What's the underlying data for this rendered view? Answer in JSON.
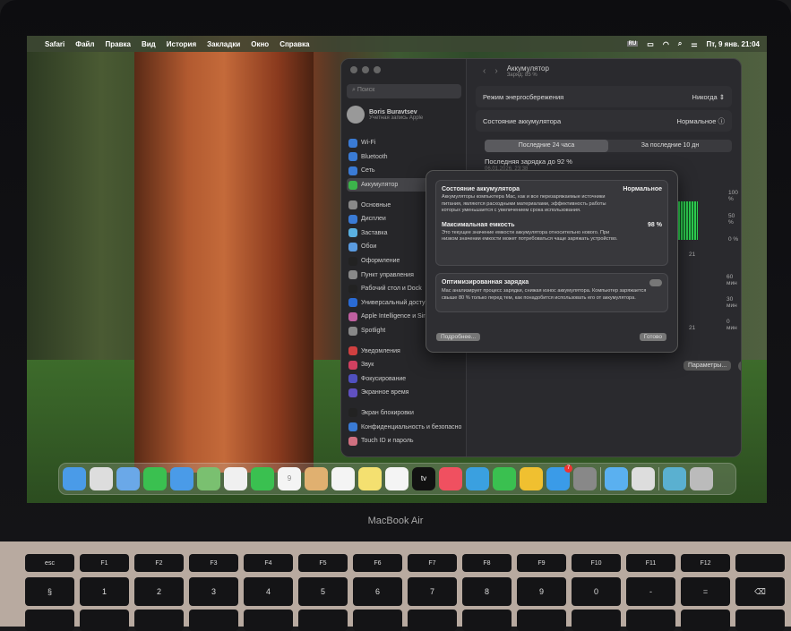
{
  "menubar": {
    "apple": "",
    "items": [
      "Safari",
      "Файл",
      "Правка",
      "Вид",
      "История",
      "Закладки",
      "Окно",
      "Справка"
    ],
    "input_lang": "RU",
    "clock": "Пт, 9 янв. 21:04"
  },
  "settings": {
    "search_placeholder": "Поиск",
    "user": {
      "name": "Boris Buravtsev",
      "subtitle": "Учетная запись Apple"
    },
    "sidebar": [
      {
        "label": "Wi-Fi",
        "color": "#3a7bd5"
      },
      {
        "label": "Bluetooth",
        "color": "#3a7bd5"
      },
      {
        "label": "Сеть",
        "color": "#3a7bd5"
      },
      {
        "label": "Аккумулятор",
        "color": "#3cb44b",
        "selected": true
      },
      {
        "label": "Основные",
        "color": "#888",
        "gap": true
      },
      {
        "label": "Дисплеи",
        "color": "#3a7bd5"
      },
      {
        "label": "Заставка",
        "color": "#5ab0e0"
      },
      {
        "label": "Обои",
        "color": "#5a9be0"
      },
      {
        "label": "Оформление",
        "color": "#222"
      },
      {
        "label": "Пункт управления",
        "color": "#888"
      },
      {
        "label": "Рабочий стол и Dock",
        "color": "#222"
      },
      {
        "label": "Универсальный доступ",
        "color": "#2a6bd5"
      },
      {
        "label": "Apple Intelligence и Siri",
        "color": "#c060a0"
      },
      {
        "label": "Spotlight",
        "color": "#888"
      },
      {
        "label": "Уведомления",
        "color": "#d04040",
        "gap": true
      },
      {
        "label": "Звук",
        "color": "#d04060"
      },
      {
        "label": "Фокусирование",
        "color": "#5050c0"
      },
      {
        "label": "Экранное время",
        "color": "#6050c0"
      },
      {
        "label": "Экран блокировки",
        "color": "#222",
        "gap": true
      },
      {
        "label": "Конфиденциальность и безопасность",
        "color": "#3a7bd5"
      },
      {
        "label": "Touch ID и пароль",
        "color": "#d07080"
      }
    ],
    "header": {
      "title": "Аккумулятор",
      "subtitle": "Заряд: 85 %"
    },
    "low_power": {
      "label": "Режим энергосбережения",
      "value": "Никогда"
    },
    "health": {
      "label": "Состояние аккумулятора",
      "value": "Нормальное"
    },
    "tabs": [
      "Последние 24 часа",
      "За последние 10 дн"
    ],
    "last_charge": {
      "label": "Последняя зарядка до 92 %",
      "date": "06.01.2026, 23:38"
    },
    "chart": {
      "level_ticks": [
        "100 %",
        "50 %",
        "0 %"
      ],
      "time_ticks": [
        "60 мин",
        "30 мин",
        "0 мин"
      ],
      "x_tick": "21"
    },
    "params_button": "Параметры...",
    "help": "?"
  },
  "dialog": {
    "health_title": "Состояние аккумулятора",
    "health_value": "Нормальное",
    "health_text": "Аккумуляторы компьютера Mac, как и все перезаряжаемые источники питания, являются расходными материалами, эффективность работы которых уменьшается с увеличением срока использования.",
    "capacity_title": "Максимальная емкость",
    "capacity_value": "98 %",
    "capacity_text": "Это текущее значение емкости аккумулятора относительно нового. При низком значении емкости может потребоваться чаще заряжать устройство.",
    "opt_title": "Оптимизированная зарядка",
    "opt_enabled": false,
    "opt_text": "Mac анализирует процесс зарядки, снижая износ аккумулятора. Компьютер заряжается свыше 80 % только перед тем, как понадобится использовать его от аккумулятора.",
    "more_button": "Подробнее...",
    "done_button": "Готово"
  },
  "dock": [
    {
      "name": "finder",
      "color": "#4a9be8"
    },
    {
      "name": "launchpad",
      "color": "#ddd"
    },
    {
      "name": "safari",
      "color": "#6aa8e8"
    },
    {
      "name": "messages",
      "color": "#3ac050"
    },
    {
      "name": "mail",
      "color": "#4a9be8"
    },
    {
      "name": "maps",
      "color": "#7ac070"
    },
    {
      "name": "photos",
      "color": "#f0f0f0"
    },
    {
      "name": "facetime",
      "color": "#3ac050"
    },
    {
      "name": "calendar",
      "color": "#f4f4f4",
      "text": "9"
    },
    {
      "name": "contacts",
      "color": "#e0b070"
    },
    {
      "name": "reminders",
      "color": "#f4f4f4"
    },
    {
      "name": "notes",
      "color": "#f4e070"
    },
    {
      "name": "freeform",
      "color": "#f4f4f4"
    },
    {
      "name": "tv",
      "color": "#111",
      "text": "tv"
    },
    {
      "name": "music",
      "color": "#f05060"
    },
    {
      "name": "keynote",
      "color": "#3aa0e0"
    },
    {
      "name": "numbers",
      "color": "#3ac050"
    },
    {
      "name": "pages",
      "color": "#f0c030"
    },
    {
      "name": "app-store",
      "color": "#3a9be8",
      "badge": "7"
    },
    {
      "name": "system-settings",
      "color": "#888"
    },
    {
      "sep": true
    },
    {
      "name": "weather",
      "color": "#5ab0f0"
    },
    {
      "name": "preview",
      "color": "#ddd"
    },
    {
      "sep": true
    },
    {
      "name": "downloads",
      "color": "#5ab0d0"
    },
    {
      "name": "trash",
      "color": "#bbb"
    }
  ],
  "brand": "MacBook Air",
  "keyboard": {
    "fn_row": [
      "esc",
      "F1",
      "F2",
      "F3",
      "F4",
      "F5",
      "F6",
      "F7",
      "F8",
      "F9",
      "F10",
      "F11",
      "F12",
      ""
    ],
    "num_row": [
      "§",
      "1",
      "2",
      "3",
      "4",
      "5",
      "6",
      "7",
      "8",
      "9",
      "0",
      "-",
      "=",
      "⌫"
    ]
  }
}
